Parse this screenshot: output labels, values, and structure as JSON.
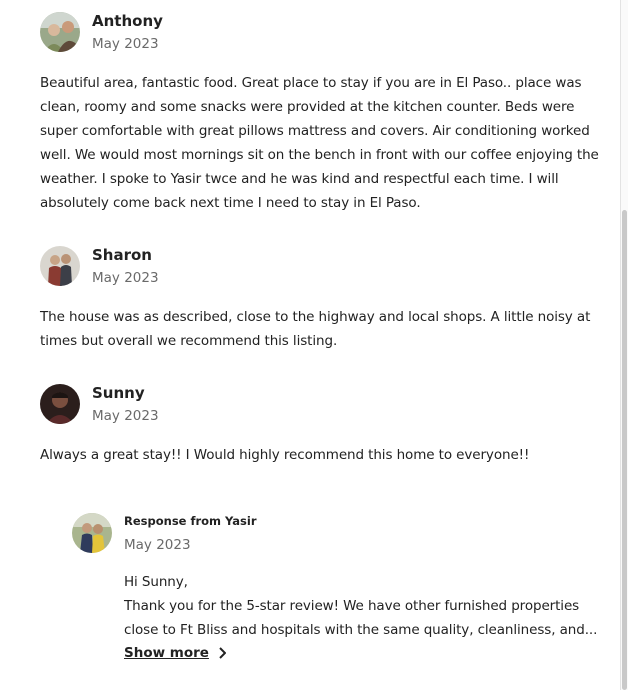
{
  "reviews": [
    {
      "name": "Anthony",
      "date": "May 2023",
      "text": "Beautiful area, fantastic food. Great place to stay if you are in El Paso.. place was clean, roomy and some snacks were provided at the kitchen counter. Beds were super comfortable with great pillows mattress and covers. Air conditioning worked well. We would most mornings sit on the bench in front with our coffee enjoying the weather. I spoke to Yasir twce and he was kind and respectful each time. I will absolutely come back next time I need to stay in El Paso."
    },
    {
      "name": "Sharon",
      "date": "May 2023",
      "text": "The house was as described, close to the highway and local shops. A little noisy at times but overall we recommend this listing."
    },
    {
      "name": "Sunny",
      "date": "May 2023",
      "text": "Always a great stay!! I Would highly recommend this home to everyone!!"
    }
  ],
  "response": {
    "title": "Response from Yasir",
    "date": "May 2023",
    "greeting": "Hi Sunny,",
    "text": "Thank you for the 5-star review! We have other furnished properties close to Ft Bliss and hospitals with the same quality, cleanliness, and...",
    "show_more": "Show more"
  }
}
